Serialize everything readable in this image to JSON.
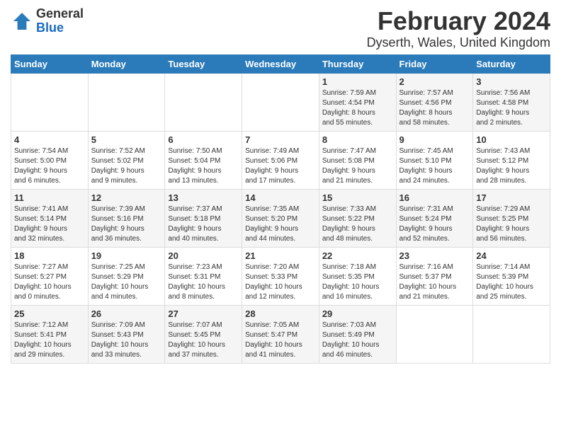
{
  "logo": {
    "general": "General",
    "blue": "Blue"
  },
  "title": "February 2024",
  "subtitle": "Dyserth, Wales, United Kingdom",
  "days_of_week": [
    "Sunday",
    "Monday",
    "Tuesday",
    "Wednesday",
    "Thursday",
    "Friday",
    "Saturday"
  ],
  "weeks": [
    [
      {
        "day": "",
        "info": ""
      },
      {
        "day": "",
        "info": ""
      },
      {
        "day": "",
        "info": ""
      },
      {
        "day": "",
        "info": ""
      },
      {
        "day": "1",
        "info": "Sunrise: 7:59 AM\nSunset: 4:54 PM\nDaylight: 8 hours\nand 55 minutes."
      },
      {
        "day": "2",
        "info": "Sunrise: 7:57 AM\nSunset: 4:56 PM\nDaylight: 8 hours\nand 58 minutes."
      },
      {
        "day": "3",
        "info": "Sunrise: 7:56 AM\nSunset: 4:58 PM\nDaylight: 9 hours\nand 2 minutes."
      }
    ],
    [
      {
        "day": "4",
        "info": "Sunrise: 7:54 AM\nSunset: 5:00 PM\nDaylight: 9 hours\nand 6 minutes."
      },
      {
        "day": "5",
        "info": "Sunrise: 7:52 AM\nSunset: 5:02 PM\nDaylight: 9 hours\nand 9 minutes."
      },
      {
        "day": "6",
        "info": "Sunrise: 7:50 AM\nSunset: 5:04 PM\nDaylight: 9 hours\nand 13 minutes."
      },
      {
        "day": "7",
        "info": "Sunrise: 7:49 AM\nSunset: 5:06 PM\nDaylight: 9 hours\nand 17 minutes."
      },
      {
        "day": "8",
        "info": "Sunrise: 7:47 AM\nSunset: 5:08 PM\nDaylight: 9 hours\nand 21 minutes."
      },
      {
        "day": "9",
        "info": "Sunrise: 7:45 AM\nSunset: 5:10 PM\nDaylight: 9 hours\nand 24 minutes."
      },
      {
        "day": "10",
        "info": "Sunrise: 7:43 AM\nSunset: 5:12 PM\nDaylight: 9 hours\nand 28 minutes."
      }
    ],
    [
      {
        "day": "11",
        "info": "Sunrise: 7:41 AM\nSunset: 5:14 PM\nDaylight: 9 hours\nand 32 minutes."
      },
      {
        "day": "12",
        "info": "Sunrise: 7:39 AM\nSunset: 5:16 PM\nDaylight: 9 hours\nand 36 minutes."
      },
      {
        "day": "13",
        "info": "Sunrise: 7:37 AM\nSunset: 5:18 PM\nDaylight: 9 hours\nand 40 minutes."
      },
      {
        "day": "14",
        "info": "Sunrise: 7:35 AM\nSunset: 5:20 PM\nDaylight: 9 hours\nand 44 minutes."
      },
      {
        "day": "15",
        "info": "Sunrise: 7:33 AM\nSunset: 5:22 PM\nDaylight: 9 hours\nand 48 minutes."
      },
      {
        "day": "16",
        "info": "Sunrise: 7:31 AM\nSunset: 5:24 PM\nDaylight: 9 hours\nand 52 minutes."
      },
      {
        "day": "17",
        "info": "Sunrise: 7:29 AM\nSunset: 5:25 PM\nDaylight: 9 hours\nand 56 minutes."
      }
    ],
    [
      {
        "day": "18",
        "info": "Sunrise: 7:27 AM\nSunset: 5:27 PM\nDaylight: 10 hours\nand 0 minutes."
      },
      {
        "day": "19",
        "info": "Sunrise: 7:25 AM\nSunset: 5:29 PM\nDaylight: 10 hours\nand 4 minutes."
      },
      {
        "day": "20",
        "info": "Sunrise: 7:23 AM\nSunset: 5:31 PM\nDaylight: 10 hours\nand 8 minutes."
      },
      {
        "day": "21",
        "info": "Sunrise: 7:20 AM\nSunset: 5:33 PM\nDaylight: 10 hours\nand 12 minutes."
      },
      {
        "day": "22",
        "info": "Sunrise: 7:18 AM\nSunset: 5:35 PM\nDaylight: 10 hours\nand 16 minutes."
      },
      {
        "day": "23",
        "info": "Sunrise: 7:16 AM\nSunset: 5:37 PM\nDaylight: 10 hours\nand 21 minutes."
      },
      {
        "day": "24",
        "info": "Sunrise: 7:14 AM\nSunset: 5:39 PM\nDaylight: 10 hours\nand 25 minutes."
      }
    ],
    [
      {
        "day": "25",
        "info": "Sunrise: 7:12 AM\nSunset: 5:41 PM\nDaylight: 10 hours\nand 29 minutes."
      },
      {
        "day": "26",
        "info": "Sunrise: 7:09 AM\nSunset: 5:43 PM\nDaylight: 10 hours\nand 33 minutes."
      },
      {
        "day": "27",
        "info": "Sunrise: 7:07 AM\nSunset: 5:45 PM\nDaylight: 10 hours\nand 37 minutes."
      },
      {
        "day": "28",
        "info": "Sunrise: 7:05 AM\nSunset: 5:47 PM\nDaylight: 10 hours\nand 41 minutes."
      },
      {
        "day": "29",
        "info": "Sunrise: 7:03 AM\nSunset: 5:49 PM\nDaylight: 10 hours\nand 46 minutes."
      },
      {
        "day": "",
        "info": ""
      },
      {
        "day": "",
        "info": ""
      }
    ]
  ]
}
